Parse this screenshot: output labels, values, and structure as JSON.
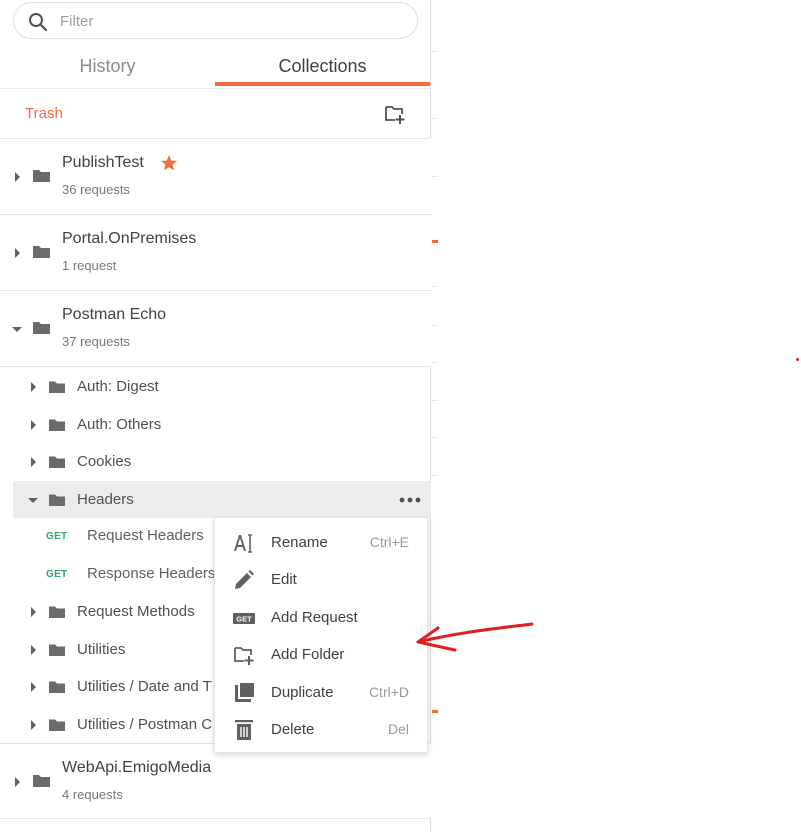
{
  "search": {
    "placeholder": "Filter"
  },
  "tabs": [
    {
      "label": "History",
      "active": false
    },
    {
      "label": "Collections",
      "active": true
    }
  ],
  "toolbar": {
    "trash_label": "Trash"
  },
  "collections": [
    {
      "name": "PublishTest",
      "count": "36 requests",
      "favorite": true,
      "expanded": false
    },
    {
      "name": "Portal.OnPremises",
      "count": "1 request",
      "favorite": false,
      "expanded": false
    },
    {
      "name": "Postman Echo",
      "count": "37 requests",
      "favorite": false,
      "expanded": true
    },
    {
      "name": "WebApi.EmigoMedia",
      "count": "4 requests",
      "favorite": false,
      "expanded": false
    }
  ],
  "echo_folders": [
    {
      "label": "Auth: Digest"
    },
    {
      "label": "Auth: Others"
    },
    {
      "label": "Cookies"
    },
    {
      "label": "Headers",
      "expanded": true
    },
    {
      "label": "Request Methods"
    },
    {
      "label": "Utilities"
    },
    {
      "label": "Utilities / Date and T"
    },
    {
      "label": "Utilities / Postman C"
    }
  ],
  "headers_requests": [
    {
      "method": "GET",
      "label": "Request Headers"
    },
    {
      "method": "GET",
      "label": "Response Headers"
    }
  ],
  "context_menu": [
    {
      "label": "Rename",
      "shortcut": "Ctrl+E",
      "icon": "rename-icon"
    },
    {
      "label": "Edit",
      "shortcut": "",
      "icon": "pencil-icon"
    },
    {
      "label": "Add Request",
      "shortcut": "",
      "icon": "get-request-icon",
      "icon_text": "GET"
    },
    {
      "label": "Add Folder",
      "shortcut": "",
      "icon": "add-folder-icon"
    },
    {
      "label": "Duplicate",
      "shortcut": "Ctrl+D",
      "icon": "duplicate-icon"
    },
    {
      "label": "Delete",
      "shortcut": "Del",
      "icon": "trash-icon"
    }
  ],
  "colors": {
    "accent": "#f26b3a",
    "get_method": "#2aa868",
    "annotation_arrow": "#e02020",
    "active_row": "#ececec"
  }
}
